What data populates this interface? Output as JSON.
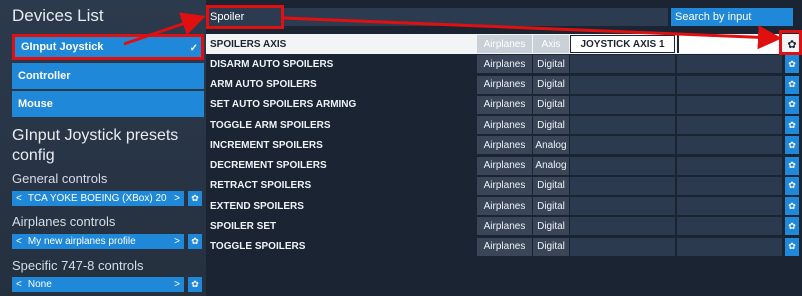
{
  "sidebar": {
    "title": "Devices List",
    "devices": [
      {
        "label": "GInput Joystick",
        "selected": true
      },
      {
        "label": "Controller",
        "selected": false
      },
      {
        "label": "Mouse",
        "selected": false
      }
    ],
    "presets_title": "GInput Joystick presets config",
    "general_label": "General controls",
    "general_value": "TCA YOKE BOEING (XBox) 20",
    "airplanes_label": "Airplanes controls",
    "airplanes_value": "My new airplanes profile",
    "specific_label": "Specific 747-8 controls",
    "specific_value": "None"
  },
  "search": {
    "value": "Spoiler",
    "mode": "Search by input"
  },
  "bindings": [
    {
      "name": "SPOILERS AXIS",
      "category": "Airplanes",
      "type": "Axis",
      "input": "JOYSTICK AXIS 1",
      "highlight": true
    },
    {
      "name": "DISARM AUTO SPOILERS",
      "category": "Airplanes",
      "type": "Digital",
      "input": ""
    },
    {
      "name": "ARM AUTO SPOILERS",
      "category": "Airplanes",
      "type": "Digital",
      "input": ""
    },
    {
      "name": "SET AUTO SPOILERS ARMING",
      "category": "Airplanes",
      "type": "Digital",
      "input": ""
    },
    {
      "name": "TOGGLE ARM SPOILERS",
      "category": "Airplanes",
      "type": "Digital",
      "input": ""
    },
    {
      "name": "INCREMENT SPOILERS",
      "category": "Airplanes",
      "type": "Analog",
      "input": ""
    },
    {
      "name": "DECREMENT SPOILERS",
      "category": "Airplanes",
      "type": "Analog",
      "input": ""
    },
    {
      "name": "RETRACT SPOILERS",
      "category": "Airplanes",
      "type": "Digital",
      "input": ""
    },
    {
      "name": "EXTEND SPOILERS",
      "category": "Airplanes",
      "type": "Digital",
      "input": ""
    },
    {
      "name": "SPOILER SET",
      "category": "Airplanes",
      "type": "Digital",
      "input": ""
    },
    {
      "name": "TOGGLE SPOILERS",
      "category": "Airplanes",
      "type": "Digital",
      "input": ""
    }
  ],
  "colors": {
    "accent": "#1f88d8",
    "annotation": "#e01010"
  }
}
